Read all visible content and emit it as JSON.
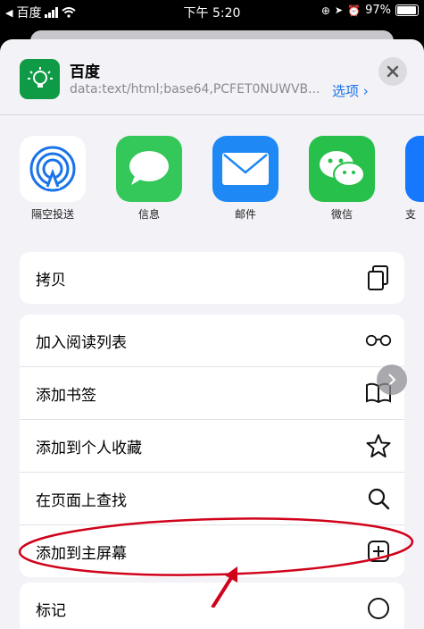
{
  "status_bar": {
    "carrier": "百度",
    "time": "下午 5:20",
    "battery": "97%"
  },
  "header": {
    "title": "百度",
    "subtitle": "data:text/html;base64,PCFET0NUWVB...",
    "options_label": "选项 ›",
    "close_icon": "close-icon"
  },
  "apps": [
    {
      "label": "隔空投送",
      "icon": "airdrop-icon"
    },
    {
      "label": "信息",
      "icon": "messages-icon"
    },
    {
      "label": "邮件",
      "icon": "mail-icon"
    },
    {
      "label": "微信",
      "icon": "wechat-icon"
    },
    {
      "label": "支",
      "icon": "alipay-icon"
    }
  ],
  "actions": {
    "copy": "拷贝",
    "reading_list": "加入阅读列表",
    "add_bookmark": "添加书签",
    "add_favorites": "添加到个人收藏",
    "find_on_page": "在页面上查找",
    "add_home_screen": "添加到主屏幕",
    "markup": "标记"
  },
  "colors": {
    "accent": "#1a73e8",
    "annotation": "#d0021b",
    "sheet_bg": "#f2f2f7"
  }
}
